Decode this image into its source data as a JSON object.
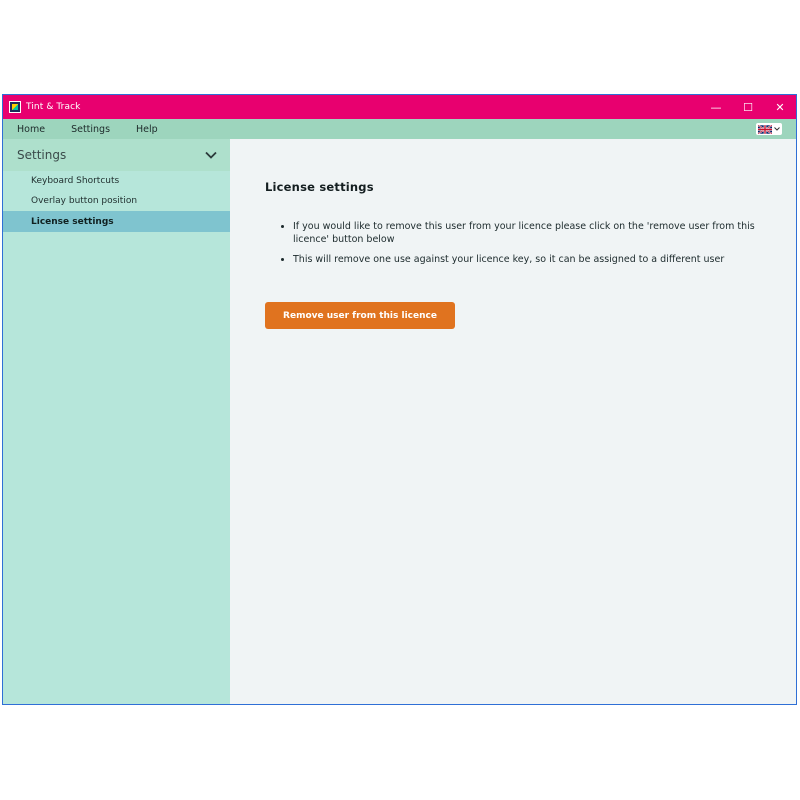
{
  "window": {
    "title": "Tint & Track",
    "controls": {
      "minimize": "—",
      "maximize": "☐",
      "close": "✕"
    }
  },
  "menu": {
    "items": [
      {
        "label": "Home"
      },
      {
        "label": "Settings"
      },
      {
        "label": "Help"
      }
    ],
    "language": {
      "selected": "English (UK)",
      "icon": "uk-flag-icon"
    }
  },
  "sidebar": {
    "header": "Settings",
    "items": [
      {
        "label": "Keyboard Shortcuts",
        "active": false
      },
      {
        "label": "Overlay button position",
        "active": false
      },
      {
        "label": "License settings",
        "active": true
      }
    ]
  },
  "content": {
    "title": "License settings",
    "bullets": [
      "If you would like to remove this user from your licence please click on the 'remove user from this licence' button below",
      "This will remove one use against your licence key, so it can be assigned to a different user"
    ],
    "button_label": "Remove user from this licence"
  },
  "colors": {
    "titlebar": "#e8006f",
    "menubar": "#9dd5bd",
    "sidebar": "#b6e6da",
    "sidebar_active": "#7fc4cf",
    "content_bg": "#f0f4f5",
    "primary_button": "#e0731f"
  }
}
